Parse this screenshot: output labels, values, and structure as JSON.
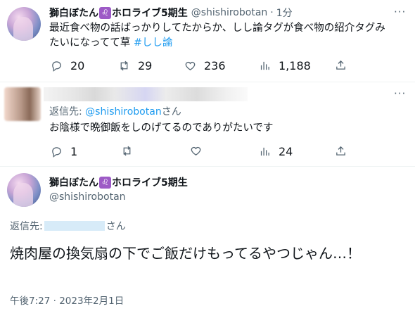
{
  "tweet1": {
    "author": "獅白ぼたん",
    "badge": "♌",
    "author_suffix": "ホロライブ5期生",
    "handle": "@shishirobotan",
    "dot": "·",
    "time": "1分",
    "more": "···",
    "text_line1": "最近食べ物の話ばっかりしてたからか、しし論タグが食べ物の紹介タグみ",
    "text_line2": "たいになってて草 ",
    "hashtag": "#しし論",
    "reply_count": "20",
    "retweet_count": "29",
    "like_count": "236",
    "view_count": "1,188"
  },
  "tweet2": {
    "reply_to_prefix": "返信先: ",
    "reply_to_handle": "@shishirobotan",
    "reply_to_suffix": "さん",
    "text": "お陰様で晩御飯をしのげてるのでありがたいです",
    "more": "···",
    "reply_count": "1",
    "retweet_count": "",
    "like_count": "",
    "view_count": "24"
  },
  "tweet3": {
    "author": "獅白ぼたん",
    "badge": "♌",
    "author_suffix": "ホロライブ5期生",
    "handle": "@shishirobotan",
    "reply_to_prefix": "返信先:",
    "reply_to_suffix": "さん",
    "text": "焼肉屋の換気扇の下でご飯だけもってるやつじゃん…！",
    "timestamp": "午後7:27 · 2023年2月1日"
  },
  "icons": [
    "reply-icon",
    "retweet-icon",
    "like-icon",
    "views-icon",
    "share-icon",
    "more-icon"
  ],
  "colors": {
    "link": "#1d9bf0",
    "muted": "#536471",
    "text": "#0f1419",
    "badge": "#9d5ac6"
  }
}
